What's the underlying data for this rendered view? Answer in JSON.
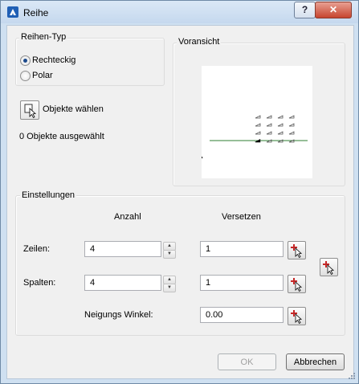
{
  "window": {
    "title": "Reihe",
    "help_label": "?",
    "close_label": "✕",
    "app_icon": "app-logo-icon"
  },
  "array_type": {
    "title": "Reihen-Typ",
    "options": [
      {
        "label": "Rechteckig",
        "checked": true
      },
      {
        "label": "Polar",
        "checked": false
      }
    ]
  },
  "preview": {
    "title": "Voransicht"
  },
  "select_objects": {
    "label": "Objekte wählen",
    "status": "0 Objekte ausgewählt",
    "icon": "select-objects-icon"
  },
  "settings": {
    "title": "Einstellungen",
    "col_count": "Anzahl",
    "col_offset": "Versetzen",
    "rows_label": "Zeilen:",
    "rows_count": "4",
    "rows_offset": "1",
    "cols_label": "Spalten:",
    "cols_count": "4",
    "cols_offset": "1",
    "angle_label": "Neigungs Winkel:",
    "angle_value": "0.00",
    "pick_icon": "pick-point-icon"
  },
  "buttons": {
    "ok": "OK",
    "cancel": "Abbrechen"
  },
  "colors": {
    "accent": "#1d4a8c",
    "preview_line": "#2e7d32"
  }
}
